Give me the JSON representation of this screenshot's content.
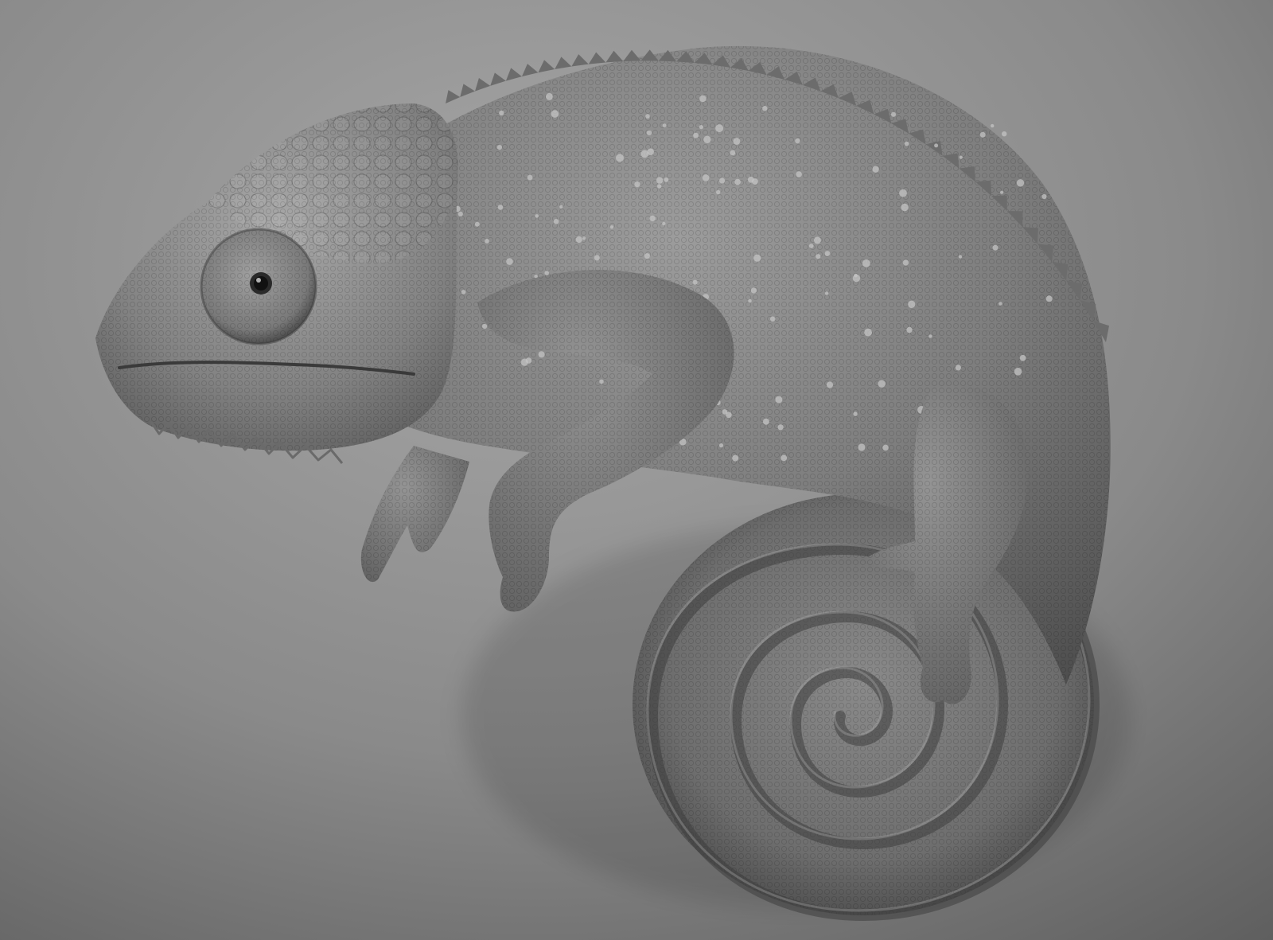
{
  "scene": {
    "subject": "chameleon",
    "palette": {
      "background_light": "#a4a4a4",
      "background_dark": "#5e5e5e",
      "skin_light": "#9a9a9a",
      "skin_mid": "#7a7a7a",
      "skin_dark": "#4a4a4a",
      "shadow": "#2e2e2e",
      "tubercle": "#c2c2c2",
      "pupil": "#111111"
    }
  }
}
